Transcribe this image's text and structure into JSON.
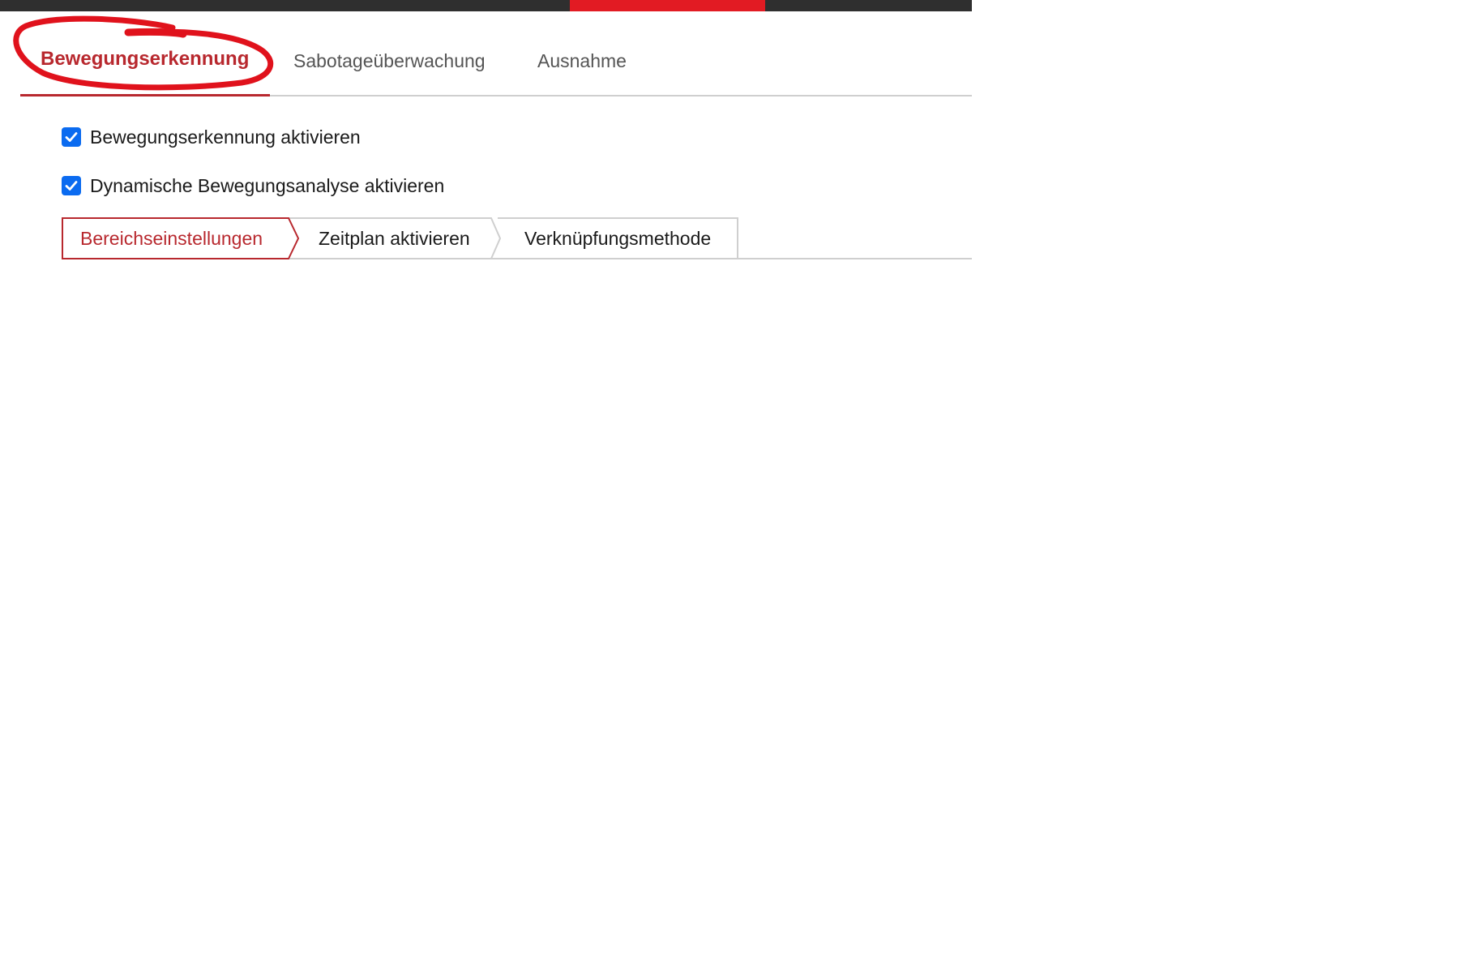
{
  "colors": {
    "accent": "#b8282e",
    "topbar": "#2f2f2f",
    "topbar_accent": "#e21b23",
    "checkbox": "#0b6bf0",
    "annotation": "#e0121c"
  },
  "main_tabs": [
    {
      "label": "Bewegungserkennung",
      "active": true
    },
    {
      "label": "Sabotageüberwachung",
      "active": false
    },
    {
      "label": "Ausnahme",
      "active": false
    }
  ],
  "options": {
    "enable_motion": {
      "label": "Bewegungserkennung aktivieren",
      "checked": true
    },
    "enable_dynamic": {
      "label": "Dynamische Bewegungsanalyse aktivieren",
      "checked": true
    }
  },
  "steps": [
    {
      "label": "Bereichseinstellungen",
      "active": true
    },
    {
      "label": "Zeitplan aktivieren",
      "active": false
    },
    {
      "label": "Verknüpfungsmethode",
      "active": false
    }
  ]
}
